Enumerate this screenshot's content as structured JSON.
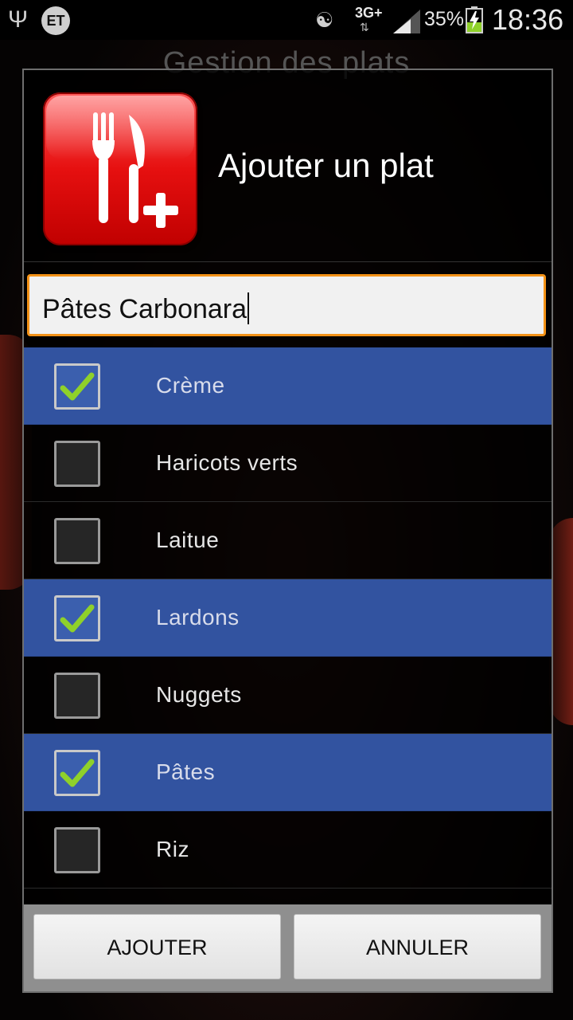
{
  "status_bar": {
    "carrier_badge": "ET",
    "network": "3G+",
    "battery_percent": "35%",
    "time": "18:36",
    "icons": [
      "usb-icon",
      "et-icon",
      "mute-icon",
      "network-icon",
      "signal-icon",
      "battery-charging-icon"
    ]
  },
  "background": {
    "title": "Gestion des plats"
  },
  "dialog": {
    "title": "Ajouter un plat",
    "icon": "fork-knife-add-icon",
    "name_input": {
      "value": "Pâtes Carbonara"
    },
    "ingredients": [
      {
        "label": "Crème",
        "checked": true
      },
      {
        "label": "Haricots verts",
        "checked": false
      },
      {
        "label": "Laitue",
        "checked": false
      },
      {
        "label": "Lardons",
        "checked": true
      },
      {
        "label": "Nuggets",
        "checked": false
      },
      {
        "label": "Pâtes",
        "checked": true
      },
      {
        "label": "Riz",
        "checked": false
      }
    ],
    "buttons": {
      "add": "AJOUTER",
      "cancel": "ANNULER"
    }
  },
  "colors": {
    "selected_row": "#3253a0",
    "input_focus_border": "#f39218",
    "icon_red": "#e61010",
    "check_green": "#8fd12a"
  }
}
